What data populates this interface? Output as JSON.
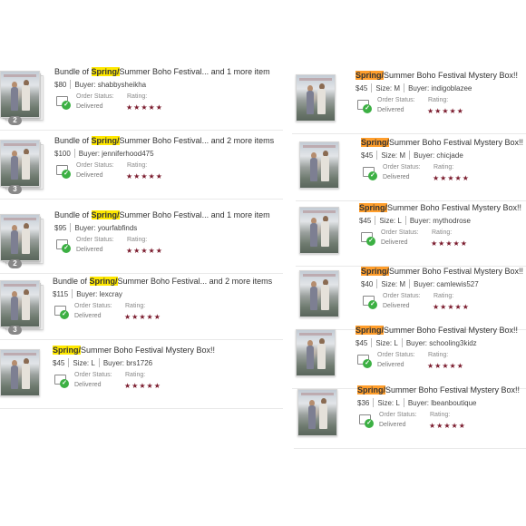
{
  "labels": {
    "order_status": "Order Status:",
    "rating": "Rating:",
    "status_value": "Delivered",
    "stars": "★★★★★",
    "size_prefix": "Size:",
    "buyer_prefix": "Buyer:",
    "check": "✓"
  },
  "left_orders": [
    {
      "title_pre": "Bundle of ",
      "title_hl": "Spring/",
      "title_post": "Summer Boho Festival... and 1 more item",
      "price": "$80",
      "size": "",
      "buyer": "shabbysheikha",
      "count": "2",
      "rating": 5
    },
    {
      "title_pre": "Bundle of ",
      "title_hl": "Spring/",
      "title_post": "Summer Boho Festival... and 2 more items",
      "price": "$100",
      "size": "",
      "buyer": "jenniferhood475",
      "count": "3",
      "rating": 5
    },
    {
      "title_pre": "Bundle of ",
      "title_hl": "Spring/",
      "title_post": "Summer Boho Festival... and 1 more item",
      "price": "$95",
      "size": "",
      "buyer": "yourfabfinds",
      "count": "2",
      "rating": 5
    },
    {
      "title_pre": "Bundle of ",
      "title_hl": "Spring/",
      "title_post": "Summer Boho Festival... and 2 more items",
      "price": "$115",
      "size": "",
      "buyer": "lexcray",
      "count": "3",
      "rating": 5
    },
    {
      "title_pre": "",
      "title_hl": "Spring/",
      "title_post": "Summer Boho Festival Mystery Box!!",
      "price": "$45",
      "size": "L",
      "buyer": "brs1726",
      "count": "",
      "rating": 5
    }
  ],
  "right_orders": [
    {
      "title_pre": "",
      "title_hl": "Spring/",
      "title_post": "Summer Boho Festival Mystery Box!!",
      "price": "$45",
      "size": "M",
      "buyer": "indigoblazee",
      "count": "",
      "rating": 5
    },
    {
      "title_pre": "",
      "title_hl": "Spring/",
      "title_post": "Summer Boho Festival Mystery Box!!",
      "price": "$45",
      "size": "M",
      "buyer": "chicjade",
      "count": "",
      "rating": 5
    },
    {
      "title_pre": "",
      "title_hl": "Spring/",
      "title_post": "Summer Boho Festival Mystery Box!!",
      "price": "$45",
      "size": "L",
      "buyer": "mythodrose",
      "count": "",
      "rating": 5
    },
    {
      "title_pre": "",
      "title_hl": "Spring/",
      "title_post": "Summer Boho Festival Mystery Box!!",
      "price": "$40",
      "size": "M",
      "buyer": "camlewis527",
      "count": "",
      "rating": 5
    },
    {
      "title_pre": "",
      "title_hl": "Spring/",
      "title_post": "Summer Boho Festival Mystery Box!!",
      "price": "$45",
      "size": "L",
      "buyer": "schooling3kidz",
      "count": "",
      "rating": 5
    },
    {
      "title_pre": "",
      "title_hl": "Spring/",
      "title_post": "Summer Boho Festival Mystery Box!!",
      "price": "$36",
      "size": "L",
      "buyer": "lbeanboutique",
      "count": "",
      "rating": 5
    }
  ],
  "colors": {
    "highlight_left": "#ffe800",
    "highlight_right": "#ff9e2c",
    "star": "#7a1a2c",
    "check": "#3cb043"
  }
}
